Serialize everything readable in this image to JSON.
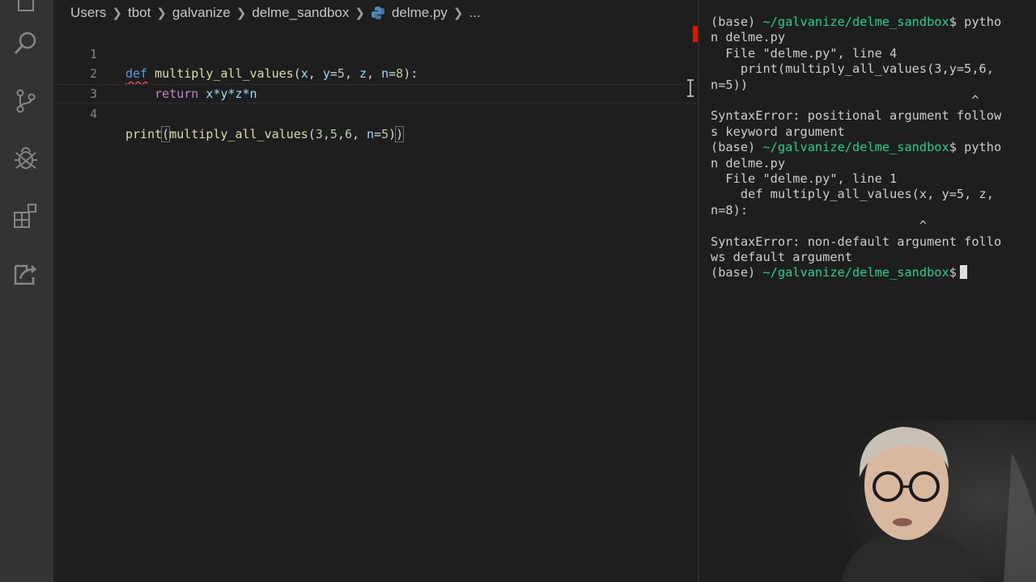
{
  "activity_bar": {
    "items": [
      {
        "name": "explorer",
        "icon": "files-icon"
      },
      {
        "name": "search",
        "icon": "search-icon"
      },
      {
        "name": "source-control",
        "icon": "git-branch-icon"
      },
      {
        "name": "debug",
        "icon": "debug-icon"
      },
      {
        "name": "extensions",
        "icon": "extensions-icon"
      },
      {
        "name": "live-share",
        "icon": "share-icon"
      }
    ]
  },
  "breadcrumb": {
    "items": [
      "Users",
      "tbot",
      "galvanize",
      "delme_sandbox",
      "delme.py",
      "..."
    ]
  },
  "editor": {
    "line_numbers": [
      "1",
      "2",
      "3",
      "4"
    ],
    "lines": {
      "l1": {
        "def": "def",
        "fn": "multiply_all_values",
        "open": "(",
        "x": "x",
        "c1": ", ",
        "y": "y",
        "eq1": "=",
        "v1": "5",
        "c2": ", ",
        "z": "z",
        "c3": ", ",
        "n": "n",
        "eq2": "=",
        "v2": "8",
        "close": "):"
      },
      "l2": {
        "ret": "return",
        "expr": "x*y*z*n"
      },
      "l4": {
        "print": "print",
        "open": "(",
        "fn": "multiply_all_values",
        "open2": "(",
        "a1": "3",
        "c1": ",",
        "a2": "5",
        "c2": ",",
        "a3": "6",
        "c3": ", ",
        "n": "n",
        "eq": "=",
        "a4": "5",
        "close2": ")",
        "close": ")"
      }
    }
  },
  "terminal": {
    "prompt_base": "(base) ",
    "path": "~/galvanize/delme_sandbox",
    "lines": [
      {
        "base": "(base) ",
        "path": "~/galvanize/delme_sandbox",
        "rest": "$ pytho"
      },
      {
        "text": "n delme.py"
      },
      {
        "text": "  File \"delme.py\", line 4"
      },
      {
        "text": "    print(multiply_all_values(3,y=5,6,"
      },
      {
        "text": "n=5))"
      },
      {
        "text": "                                   ^"
      },
      {
        "text": "SyntaxError: positional argument follow"
      },
      {
        "text": "s keyword argument"
      },
      {
        "base": "(base) ",
        "path": "~/galvanize/delme_sandbox",
        "rest": "$ pytho"
      },
      {
        "text": "n delme.py"
      },
      {
        "text": "  File \"delme.py\", line 1"
      },
      {
        "text": "    def multiply_all_values(x, y=5, z,"
      },
      {
        "text": "n=8):"
      },
      {
        "text": "                            ^"
      },
      {
        "text": "SyntaxError: non-default argument follo"
      },
      {
        "text": "ws default argument"
      },
      {
        "base": "(base) ",
        "path": "~/galvanize/delme_sandbox",
        "rest": "$"
      }
    ]
  },
  "colors": {
    "background": "#1e1e1e",
    "activity_bar": "#333333",
    "keyword": "#569cd6",
    "control_keyword": "#c586c0",
    "function": "#dcdcaa",
    "parameter": "#9cdcfe",
    "number": "#b5cea8",
    "terminal_path": "#23d18b",
    "error_marker": "#e51400"
  }
}
